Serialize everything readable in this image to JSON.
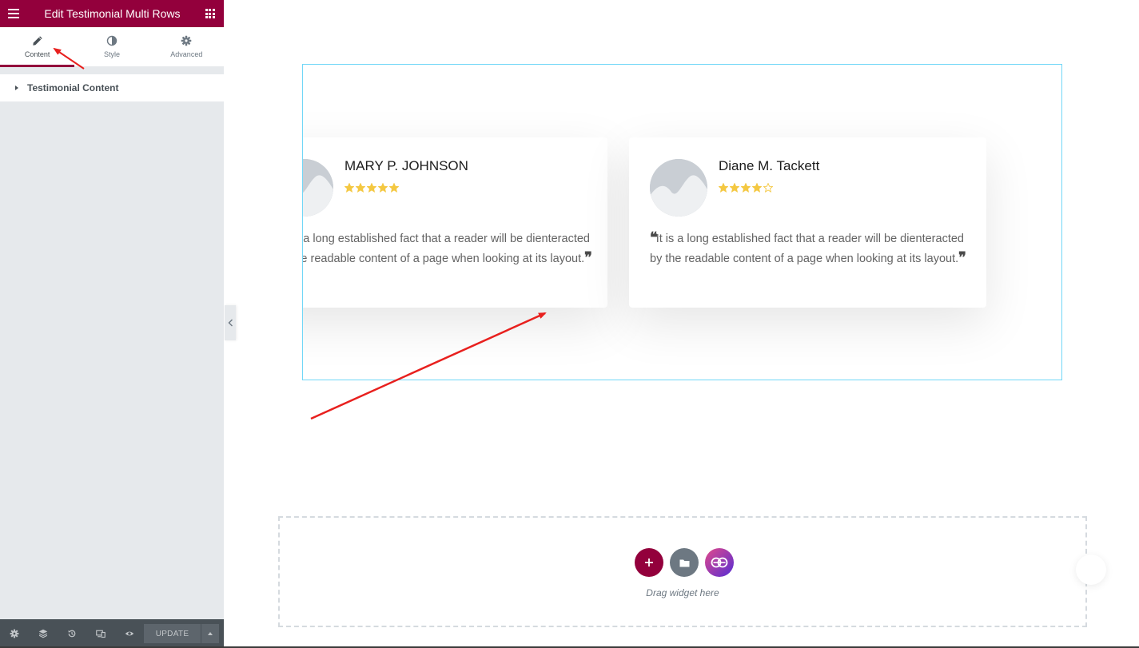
{
  "sidebar": {
    "title": "Edit Testimonial Multi Rows",
    "tabs": [
      {
        "label": "Content",
        "icon": "pencil-icon",
        "active": true
      },
      {
        "label": "Style",
        "icon": "half-circle-icon",
        "active": false
      },
      {
        "label": "Advanced",
        "icon": "gear-icon",
        "active": false
      }
    ],
    "section": {
      "label": "Testimonial Content"
    },
    "footer": {
      "icons": [
        "settings-icon",
        "layers-icon",
        "history-icon",
        "responsive-icon",
        "preview-eye-icon"
      ],
      "update_label": "UPDATE"
    }
  },
  "testimonials": [
    {
      "name": "MARY P. JOHNSON",
      "rating": 5,
      "text": "It is a long established fact that a reader will be dienteracted by the readable content of a page when looking at its layout."
    },
    {
      "name": "Diane M. Tackett",
      "rating": 4,
      "text": "It is a long established fact that a reader will be dienteracted by the readable content of a page when looking at its layout."
    }
  ],
  "drop_zone": {
    "label": "Drag widget here",
    "buttons": [
      "add-section",
      "add-template",
      "essential-addons"
    ]
  },
  "colors": {
    "brand": "#93003c",
    "star": "#f4c842",
    "annotation_arrow": "#e8201e",
    "section_outline": "#71d7f7"
  }
}
